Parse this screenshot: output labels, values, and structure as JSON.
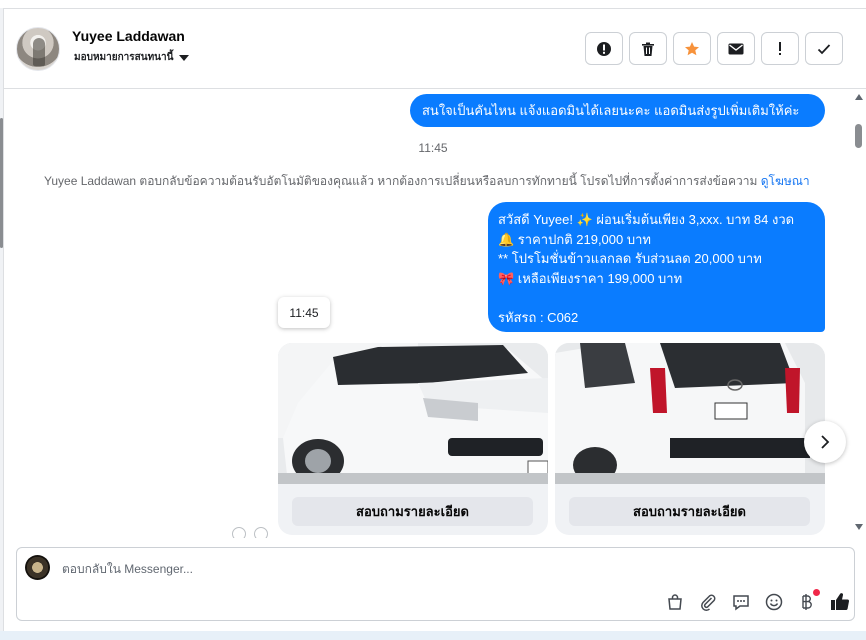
{
  "header": {
    "contact_name": "Yuyee Laddawan",
    "assign_label": "มอบหมายการสนทนานี้",
    "actions": [
      {
        "icon": "alert-circle-icon",
        "label": ""
      },
      {
        "icon": "trash-icon",
        "label": ""
      },
      {
        "icon": "star-icon",
        "label": ""
      },
      {
        "icon": "envelope-icon",
        "label": ""
      },
      {
        "icon": "exclamation-icon",
        "label": ""
      },
      {
        "icon": "checkmark-icon",
        "label": ""
      }
    ]
  },
  "messages": {
    "outgoing_1": "สนใจเป็นคันไหน แจ้งแอดมินได้เลยนะคะ แอดมินส่งรูปเพิ่มเติมให้ค่ะ",
    "timestamp_1": "11:45",
    "auto_reply_note": "Yuyee Laddawan ตอบกลับข้อความต้อนรับอัตโนมัติของคุณแล้ว หากต้องการเปลี่ยนหรือลบการทักทายนี้ โปรดไปที่การตั้งค่าการส่งข้อความ",
    "auto_reply_link": "ดูโฆษณา",
    "outgoing_2": {
      "line1": "สวัสดี Yuyee! ✨  ผ่อนเริ่มต้นเพียง 3,xxx. บาท 84 งวด",
      "line2": "🔔 ราคาปกติ 219,000 บาท",
      "line3": "** โปรโมชั่นข้าวแลกลด รับส่วนลด 20,000 บาท",
      "line4": "🎀  เหลือเพียงราคา 199,000 บาท",
      "line5": "",
      "line6": " รหัสรถ : C062"
    },
    "hover_time": "11:45",
    "cards": [
      {
        "button_label": "สอบถามรายละเอียด"
      },
      {
        "button_label": "สอบถามรายละเอียด"
      }
    ]
  },
  "composer": {
    "placeholder": "ตอบกลับใน Messenger...",
    "tools": [
      "shopping-bag-icon",
      "paperclip-icon",
      "chat-bubble-icon",
      "smiley-icon",
      "baht-icon",
      "thumbs-up-icon"
    ]
  },
  "colors": {
    "accent": "#0a7cff",
    "link": "#1877f2",
    "star": "#f7923b",
    "notification": "#f02849"
  }
}
